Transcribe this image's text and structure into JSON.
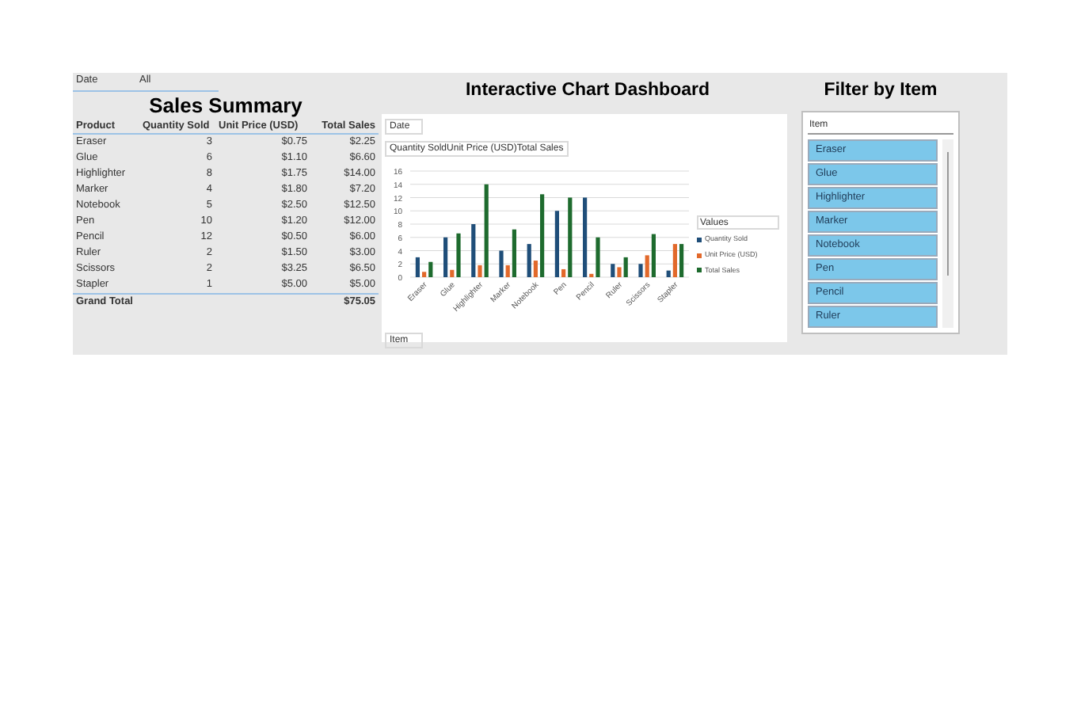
{
  "summary": {
    "filter_label": "Date",
    "filter_value": "All",
    "title": "Sales Summary",
    "columns": [
      "Product",
      "Quantity Sold",
      "Unit Price (USD)",
      "Total Sales"
    ],
    "rows": [
      [
        "Eraser",
        "3",
        "$0.75",
        "$2.25"
      ],
      [
        "Glue",
        "6",
        "$1.10",
        "$6.60"
      ],
      [
        "Highlighter",
        "8",
        "$1.75",
        "$14.00"
      ],
      [
        "Marker",
        "4",
        "$1.80",
        "$7.20"
      ],
      [
        "Notebook",
        "5",
        "$2.50",
        "$12.50"
      ],
      [
        "Pen",
        "10",
        "$1.20",
        "$12.00"
      ],
      [
        "Pencil",
        "12",
        "$0.50",
        "$6.00"
      ],
      [
        "Ruler",
        "2",
        "$1.50",
        "$3.00"
      ],
      [
        "Scissors",
        "2",
        "$3.25",
        "$6.50"
      ],
      [
        "Stapler",
        "1",
        "$5.00",
        "$5.00"
      ]
    ],
    "total": {
      "label": "Grand Total",
      "value": "$75.05"
    }
  },
  "dashboard": {
    "title": "Interactive Chart Dashboard",
    "date_button": "Date",
    "item_button": "Item",
    "legend_title": "Values",
    "chart_data": {
      "type": "bar",
      "title": "Quantity SoldUnit Price (USD)Total Sales",
      "categories": [
        "Eraser",
        "Glue",
        "Highlighter",
        "Marker",
        "Notebook",
        "Pen",
        "Pencil",
        "Ruler",
        "Scissors",
        "Stapler"
      ],
      "series": [
        {
          "name": "Quantity Sold",
          "color": "#1f4e79",
          "values": [
            3,
            6,
            8,
            4,
            5,
            10,
            12,
            2,
            2,
            1
          ]
        },
        {
          "name": "Unit Price (USD)",
          "color": "#e2692b",
          "values": [
            0.8,
            1.1,
            1.8,
            1.8,
            2.5,
            1.2,
            0.5,
            1.5,
            3.3,
            5
          ]
        },
        {
          "name": "Total Sales",
          "color": "#1e6b2e",
          "values": [
            2.3,
            6.6,
            14,
            7.2,
            12.5,
            12,
            6,
            3,
            6.5,
            5
          ]
        }
      ],
      "grid": true,
      "legend": "right",
      "ylim": [
        0,
        16
      ],
      "yticks": [
        0,
        2,
        4,
        6,
        8,
        10,
        12,
        14,
        16
      ]
    }
  },
  "filter": {
    "title": "Filter by Item",
    "header": "Item",
    "items": [
      {
        "label": "Eraser",
        "selected": true
      },
      {
        "label": "Glue",
        "selected": true
      },
      {
        "label": "Highlighter",
        "selected": true
      },
      {
        "label": "Marker",
        "selected": true
      },
      {
        "label": "Notebook",
        "selected": true
      },
      {
        "label": "Pen",
        "selected": true
      },
      {
        "label": "Pencil",
        "selected": true
      },
      {
        "label": "Ruler",
        "selected": true
      }
    ]
  }
}
